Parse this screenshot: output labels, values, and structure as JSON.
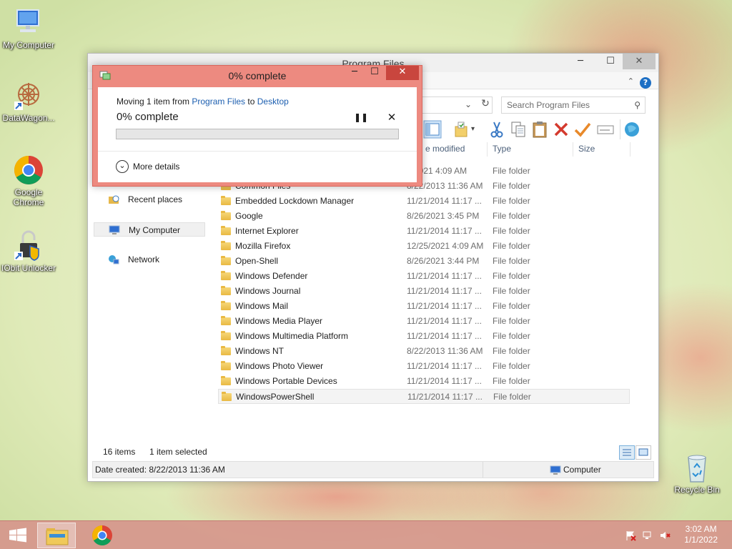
{
  "desktop": {
    "icons": [
      {
        "label": "My Computer"
      },
      {
        "label": "DataWagon..."
      },
      {
        "label": "Google Chrome"
      },
      {
        "label": "IObit Unlocker"
      },
      {
        "label": "Recycle Bin"
      }
    ]
  },
  "explorer": {
    "title": "Program Files",
    "controls": {
      "minimize": "─",
      "maximize": "☐",
      "close": "✕"
    },
    "search_placeholder": "Search Program Files",
    "columns": {
      "date": "e modified",
      "type": "Type",
      "size": "Size"
    },
    "nav": [
      {
        "label": "Recent places"
      },
      {
        "label": "My Computer"
      },
      {
        "label": "Network"
      }
    ],
    "rows": [
      {
        "name": "",
        "date": "5/2021 4:09 AM",
        "type": "File folder"
      },
      {
        "name": "Common Files",
        "date": "8/22/2013 11:36 AM",
        "type": "File folder"
      },
      {
        "name": "Embedded Lockdown Manager",
        "date": "11/21/2014 11:17 ...",
        "type": "File folder"
      },
      {
        "name": "Google",
        "date": "8/26/2021 3:45 PM",
        "type": "File folder"
      },
      {
        "name": "Internet Explorer",
        "date": "11/21/2014 11:17 ...",
        "type": "File folder"
      },
      {
        "name": "Mozilla Firefox",
        "date": "12/25/2021 4:09 AM",
        "type": "File folder"
      },
      {
        "name": "Open-Shell",
        "date": "8/26/2021 3:44 PM",
        "type": "File folder"
      },
      {
        "name": "Windows Defender",
        "date": "11/21/2014 11:17 ...",
        "type": "File folder"
      },
      {
        "name": "Windows Journal",
        "date": "11/21/2014 11:17 ...",
        "type": "File folder"
      },
      {
        "name": "Windows Mail",
        "date": "11/21/2014 11:17 ...",
        "type": "File folder"
      },
      {
        "name": "Windows Media Player",
        "date": "11/21/2014 11:17 ...",
        "type": "File folder"
      },
      {
        "name": "Windows Multimedia Platform",
        "date": "11/21/2014 11:17 ...",
        "type": "File folder"
      },
      {
        "name": "Windows NT",
        "date": "8/22/2013 11:36 AM",
        "type": "File folder"
      },
      {
        "name": "Windows Photo Viewer",
        "date": "11/21/2014 11:17 ...",
        "type": "File folder"
      },
      {
        "name": "Windows Portable Devices",
        "date": "11/21/2014 11:17 ...",
        "type": "File folder"
      },
      {
        "name": "WindowsPowerShell",
        "date": "11/21/2014 11:17 ...",
        "type": "File folder"
      }
    ],
    "status": {
      "items": "16 items",
      "selected": "1 item selected"
    },
    "details": {
      "date_created": "Date created: 8/22/2013 11:36 AM",
      "location": "Computer"
    }
  },
  "dialog": {
    "title": "0% complete",
    "moving_prefix": "Moving 1 item from",
    "source": "Program Files",
    "to_word": "to",
    "destination": "Desktop",
    "percent_text": "0% complete",
    "progress_fraction": 0,
    "pause": "❚❚",
    "stop": "✕",
    "more_details": "More details",
    "controls": {
      "minimize": "─",
      "maximize": "☐",
      "close": "✕"
    }
  },
  "taskbar": {
    "time": "3:02 AM",
    "date": "1/1/2022"
  },
  "colors": {
    "dialog_frame": "#ed8a80",
    "dialog_close": "#c9463e",
    "link": "#1d5fb0",
    "taskbar": "#d6968c"
  }
}
